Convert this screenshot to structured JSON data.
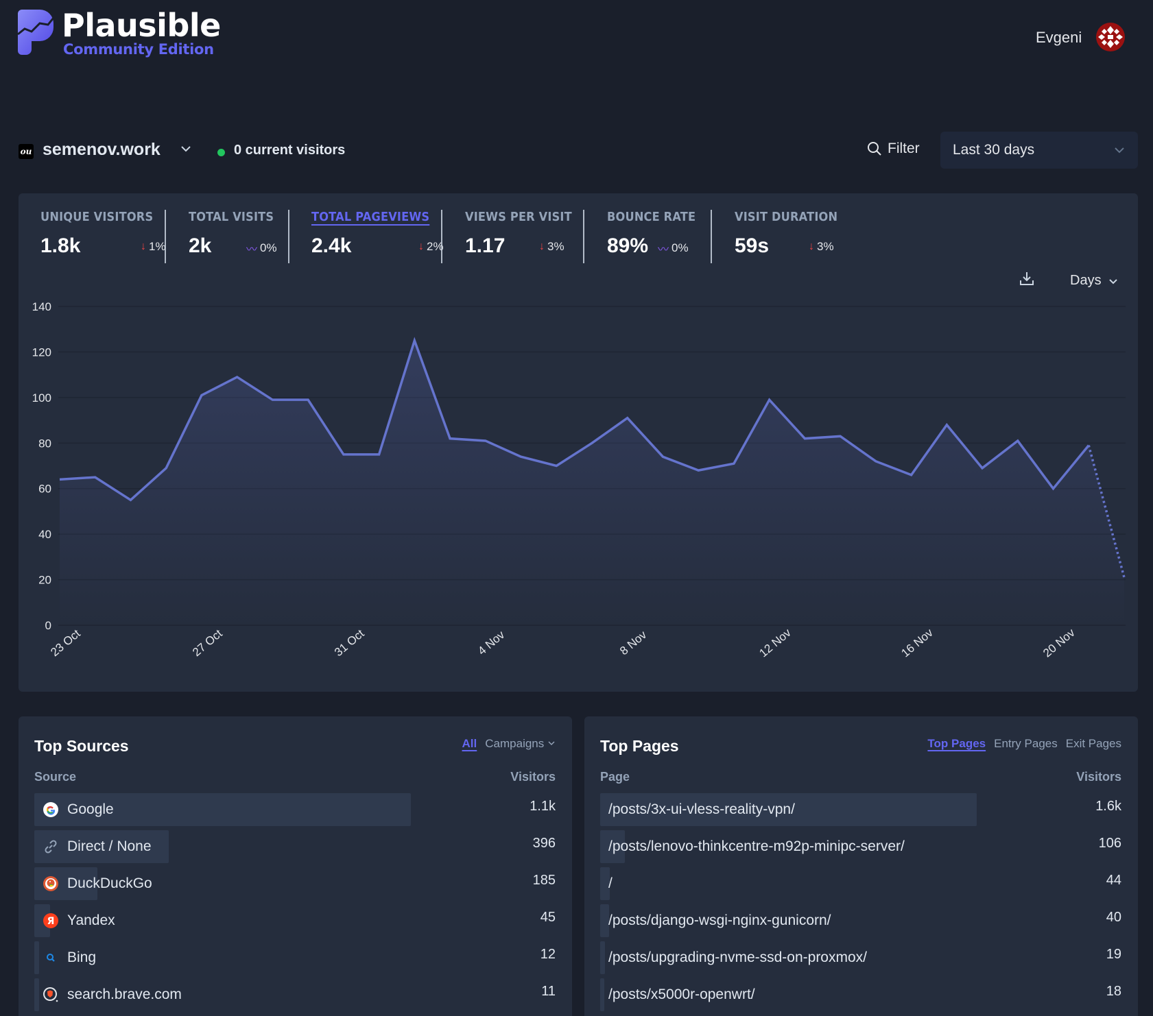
{
  "header": {
    "brand_title": "Plausible",
    "brand_subtitle": "Community Edition",
    "user_name": "Evgeni"
  },
  "site": {
    "favicon_text": "ou",
    "name": "semenov.work",
    "live_visitors": "0 current visitors",
    "filter_label": "Filter",
    "period": "Last 30 days"
  },
  "stats": [
    {
      "label": "UNIQUE VISITORS",
      "value": "1.8k",
      "change": "1%",
      "trend": "down",
      "active": false
    },
    {
      "label": "TOTAL VISITS",
      "value": "2k",
      "change": "0%",
      "trend": "flat",
      "active": false
    },
    {
      "label": "TOTAL PAGEVIEWS",
      "value": "2.4k",
      "change": "2%",
      "trend": "down",
      "active": true
    },
    {
      "label": "VIEWS PER VISIT",
      "value": "1.17",
      "change": "3%",
      "trend": "down",
      "active": false
    },
    {
      "label": "BOUNCE RATE",
      "value": "89%",
      "change": "0%",
      "trend": "flat",
      "active": false
    },
    {
      "label": "VISIT DURATION",
      "value": "59s",
      "change": "3%",
      "trend": "down",
      "active": false
    }
  ],
  "chart_controls": {
    "interval": "Days"
  },
  "chart_data": {
    "type": "area",
    "title": "",
    "xlabel": "",
    "ylabel": "",
    "ylim": [
      0,
      140
    ],
    "yticks": [
      0,
      20,
      40,
      60,
      80,
      100,
      120,
      140
    ],
    "grid": true,
    "x": [
      "23 Oct",
      "24 Oct",
      "25 Oct",
      "26 Oct",
      "27 Oct",
      "28 Oct",
      "29 Oct",
      "30 Oct",
      "31 Oct",
      "1 Nov",
      "2 Nov",
      "3 Nov",
      "4 Nov",
      "5 Nov",
      "6 Nov",
      "7 Nov",
      "8 Nov",
      "9 Nov",
      "10 Nov",
      "11 Nov",
      "12 Nov",
      "13 Nov",
      "14 Nov",
      "15 Nov",
      "16 Nov",
      "17 Nov",
      "18 Nov",
      "19 Nov",
      "20 Nov",
      "21 Nov",
      "22 Nov"
    ],
    "xtick_labels": [
      "23 Oct",
      "27 Oct",
      "31 Oct",
      "4 Nov",
      "8 Nov",
      "12 Nov",
      "16 Nov",
      "20 Nov"
    ],
    "series": [
      {
        "name": "Pageviews",
        "color": "#6574cd",
        "values": [
          64,
          65,
          55,
          69,
          101,
          109,
          99,
          99,
          75,
          75,
          125,
          82,
          81,
          74,
          70,
          80,
          91,
          74,
          68,
          71,
          99,
          82,
          83,
          72,
          66,
          88,
          69,
          81,
          60,
          79,
          21
        ],
        "incomplete_last_point": true
      }
    ]
  },
  "top_sources": {
    "title": "Top Sources",
    "tabs": [
      {
        "label": "All",
        "active": true
      },
      {
        "label": "Campaigns",
        "active": false
      }
    ],
    "col_label": "Source",
    "col_value": "Visitors",
    "rows": [
      {
        "label": "Google",
        "value": "1.1k",
        "icon": "google-icon",
        "share": 0.84
      },
      {
        "label": "Direct / None",
        "value": "396",
        "icon": "link-icon",
        "share": 0.3
      },
      {
        "label": "DuckDuckGo",
        "value": "185",
        "icon": "duckduckgo-icon",
        "share": 0.14
      },
      {
        "label": "Yandex",
        "value": "45",
        "icon": "yandex-icon",
        "share": 0.035
      },
      {
        "label": "Bing",
        "value": "12",
        "icon": "bing-icon",
        "share": 0.01
      },
      {
        "label": "search.brave.com",
        "value": "11",
        "icon": "brave-icon",
        "share": 0.01
      }
    ]
  },
  "top_pages": {
    "title": "Top Pages",
    "tabs": [
      {
        "label": "Top Pages",
        "active": true
      },
      {
        "label": "Entry Pages",
        "active": false
      },
      {
        "label": "Exit Pages",
        "active": false
      }
    ],
    "col_label": "Page",
    "col_value": "Visitors",
    "rows": [
      {
        "label": "/posts/3x-ui-vless-reality-vpn/",
        "value": "1.6k",
        "share": 0.84
      },
      {
        "label": "/posts/lenovo-thinkcentre-m92p-minipc-server/",
        "value": "106",
        "share": 0.055
      },
      {
        "label": "/",
        "value": "44",
        "share": 0.022
      },
      {
        "label": "/posts/django-wsgi-nginx-gunicorn/",
        "value": "40",
        "share": 0.02
      },
      {
        "label": "/posts/upgrading-nvme-ssd-on-proxmox/",
        "value": "19",
        "share": 0.01
      },
      {
        "label": "/posts/x5000r-openwrt/",
        "value": "18",
        "share": 0.009
      }
    ]
  }
}
